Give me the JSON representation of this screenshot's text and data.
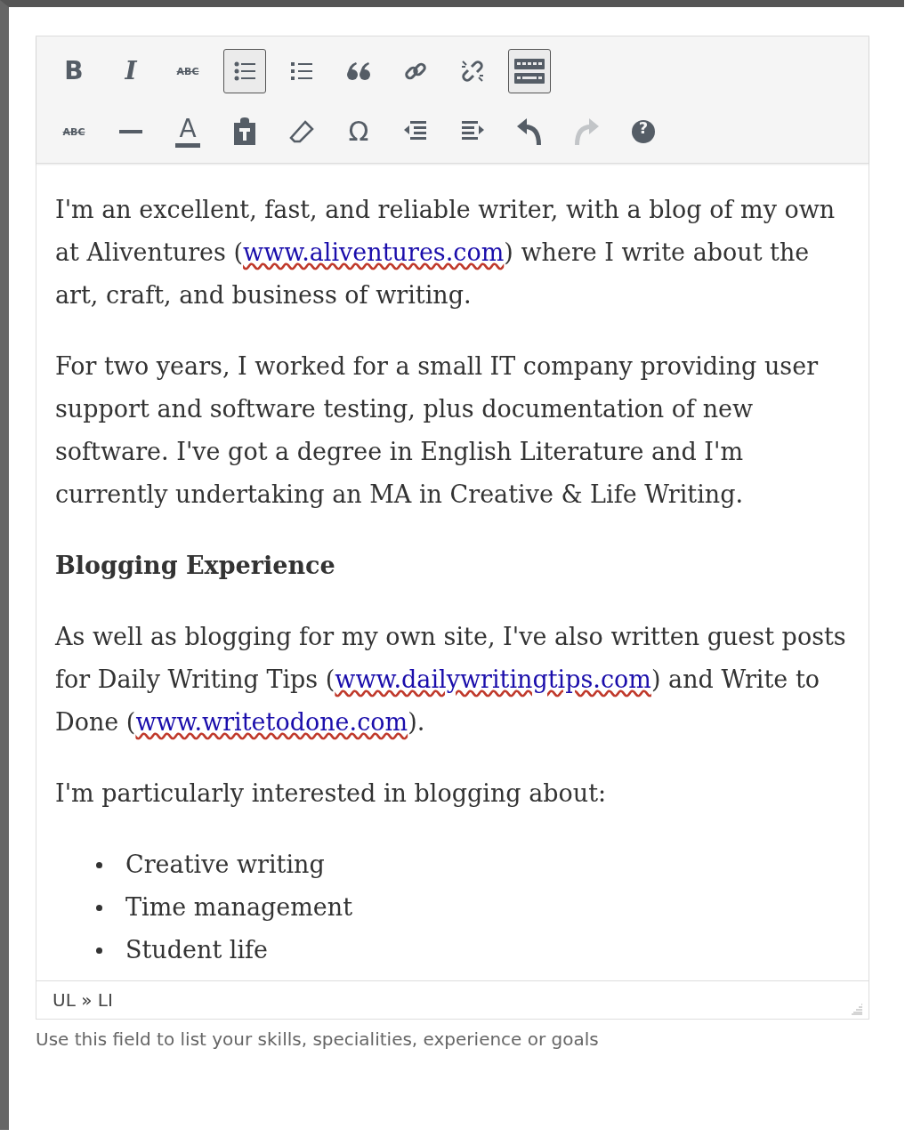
{
  "toolbar": {
    "rows": [
      [
        {
          "kind": "bold",
          "label": "B",
          "active": false,
          "disabled": false
        },
        {
          "kind": "italic",
          "label": "I",
          "active": false,
          "disabled": false
        },
        {
          "kind": "strikethrough",
          "label": "ABC",
          "active": false,
          "disabled": false
        },
        {
          "kind": "bullet-list",
          "active": true,
          "disabled": false
        },
        {
          "kind": "numbered-list",
          "active": false,
          "disabled": false
        },
        {
          "kind": "quote",
          "active": false,
          "disabled": false
        },
        {
          "kind": "link",
          "active": false,
          "disabled": false
        },
        {
          "kind": "unlink",
          "active": false,
          "disabled": false
        },
        {
          "kind": "toolbar-toggle",
          "active": true,
          "disabled": false
        }
      ],
      [
        {
          "kind": "strikethrough",
          "label": "ABC",
          "active": false,
          "disabled": false
        },
        {
          "kind": "horizontal-line",
          "active": false,
          "disabled": false
        },
        {
          "kind": "text-color",
          "label": "A",
          "active": false,
          "disabled": false
        },
        {
          "kind": "paste-text",
          "active": false,
          "disabled": false
        },
        {
          "kind": "eraser",
          "active": false,
          "disabled": false
        },
        {
          "kind": "omega",
          "label": "Ω",
          "active": false,
          "disabled": false
        },
        {
          "kind": "outdent",
          "active": false,
          "disabled": false
        },
        {
          "kind": "indent",
          "active": false,
          "disabled": false
        },
        {
          "kind": "undo",
          "active": false,
          "disabled": false
        },
        {
          "kind": "redo",
          "active": false,
          "disabled": true
        },
        {
          "kind": "help",
          "label": "?",
          "active": false,
          "disabled": false
        }
      ]
    ]
  },
  "content": [
    {
      "kind": "paragraph",
      "parts": [
        {
          "text": "I'm an excellent, fast, and reliable writer, with a blog of my own at Aliventures ("
        },
        {
          "link": "www.aliventures.com"
        },
        {
          "text": ") where I write about the art, craft, and business of writing."
        }
      ]
    },
    {
      "kind": "paragraph",
      "parts": [
        {
          "text": "For two years, I worked for a small IT company providing user support and software testing, plus documentation of new software. I've got a degree in English Literature and I'm currently undertaking an MA in Creative & Life Writing."
        }
      ]
    },
    {
      "kind": "heading",
      "parts": [
        {
          "text": "Blogging Experience"
        }
      ]
    },
    {
      "kind": "paragraph",
      "parts": [
        {
          "text": "As well as blogging for my own site, I've also written guest posts for Daily Writing Tips ("
        },
        {
          "link": "www.dailywritingtips.com"
        },
        {
          "text": ") and Write to Done ("
        },
        {
          "link": "www.writetodone.com"
        },
        {
          "text": ")."
        }
      ]
    },
    {
      "kind": "paragraph",
      "parts": [
        {
          "text": "I'm particularly interested in blogging about:"
        }
      ]
    },
    {
      "kind": "list",
      "items": [
        "Creative writing",
        "Time management",
        "Student life"
      ]
    }
  ],
  "status_path": "UL » LI",
  "hint": "Use this field to list your skills, specialities, experience or goals"
}
